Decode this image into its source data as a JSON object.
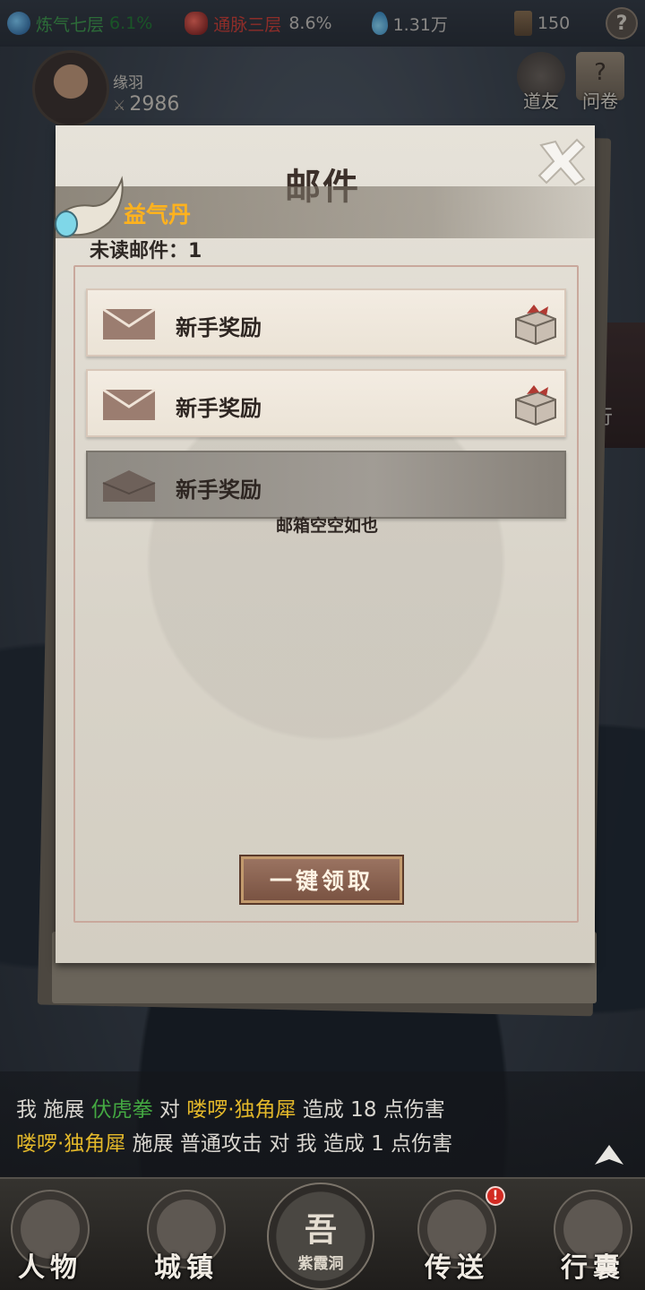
{
  "topbar": {
    "realm": {
      "name": "炼气七层",
      "pct": "6.1%"
    },
    "meridian": {
      "name": "通脉三层",
      "pct": "8.6%"
    },
    "spirit": {
      "value": "1.31万"
    },
    "scroll": {
      "value": "150"
    },
    "help_label": "?"
  },
  "player": {
    "name": "缘羽",
    "power": "2986"
  },
  "side_buttons": {
    "friend": "道友",
    "survey": "问卷"
  },
  "background": {
    "sign_text": "行"
  },
  "mail_panel": {
    "title": "邮件",
    "toast_item": "益气丹",
    "unread_label": "未读邮件：1",
    "mails": [
      {
        "title": "新手奖励",
        "state": "unread",
        "has_attachment": true
      },
      {
        "title": "新手奖励",
        "state": "unread",
        "has_attachment": true
      },
      {
        "title": "新手奖励",
        "state": "read",
        "has_attachment": false
      }
    ],
    "empty_text": "邮箱空空如也",
    "claim_all_label": "一键领取"
  },
  "battle_log": {
    "line1": {
      "a": "我 施展 ",
      "skill": "伏虎拳",
      "b": " 对 ",
      "target": "喽啰·独角犀",
      "c": " 造成 18 点伤害"
    },
    "line2": {
      "actor": "喽啰·独角犀",
      "a": " 施展 普通攻击 对 我 造成 1 点伤害"
    }
  },
  "nav": {
    "character": "人物",
    "town": "城镇",
    "home_glyph": "吾",
    "home_label": "紫霞洞",
    "teleport": "传送",
    "bag": "行囊",
    "teleport_badge": "!"
  },
  "colors": {
    "realm_green": "#3d9c4b",
    "meridian_red": "#d23c33",
    "toast_orange": "#ffb21e",
    "skill_green": "#44a942",
    "target_yellow": "#e3b82a"
  }
}
